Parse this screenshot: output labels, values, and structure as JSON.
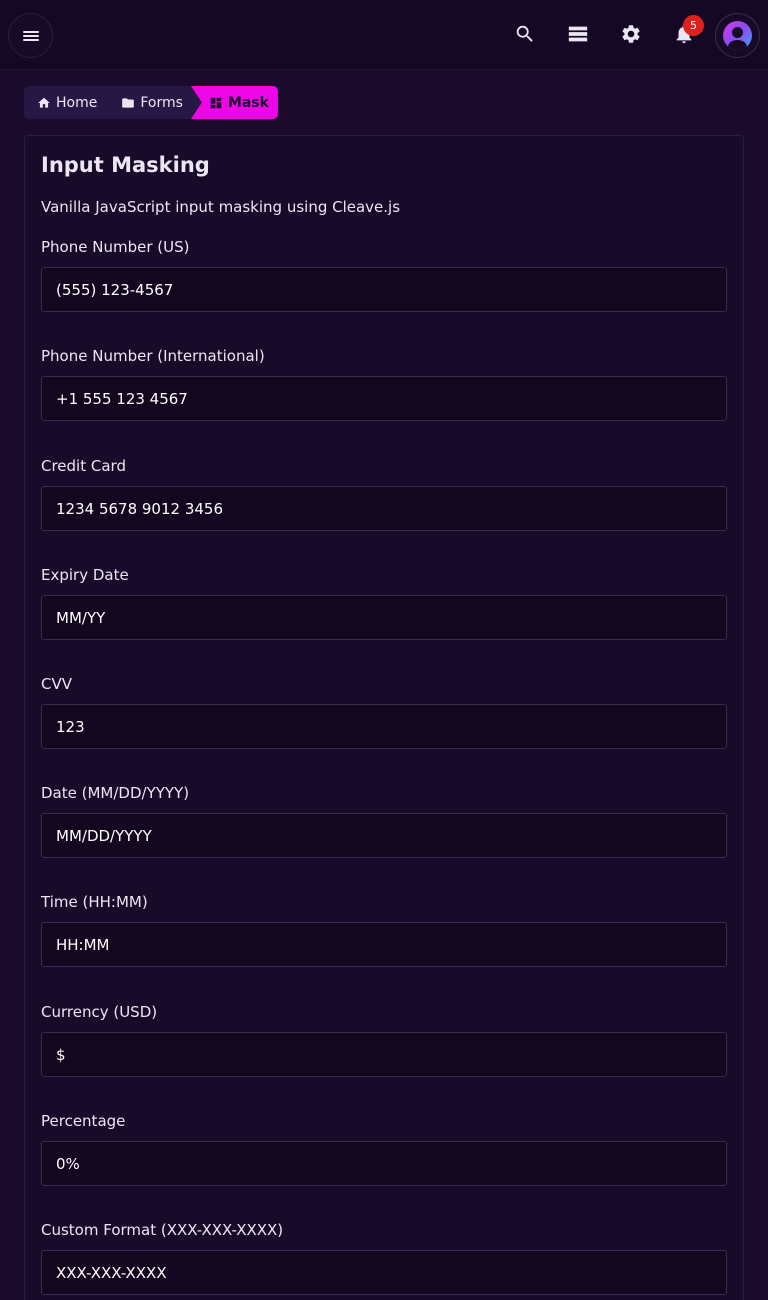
{
  "header": {
    "notification_count": "5",
    "icons": [
      "menu-icon",
      "search-icon",
      "storage-icon",
      "gear-icon",
      "bell-icon",
      "user-icon"
    ]
  },
  "breadcrumb": {
    "home": "Home",
    "forms": "Forms",
    "current": "Mask",
    "active_color": "#ee06e8"
  },
  "card": {
    "title": "Input Masking",
    "description": "Vanilla JavaScript input masking using Cleave.js"
  },
  "fields": [
    {
      "label": "Phone Number (US)",
      "value": "(555) 123-4567",
      "placeholder": ""
    },
    {
      "label": "Phone Number (International)",
      "value": "+1 555 123 4567",
      "placeholder": ""
    },
    {
      "label": "Credit Card",
      "value": "1234 5678 9012 3456",
      "placeholder": ""
    },
    {
      "label": "Expiry Date",
      "value": "",
      "placeholder": "MM/YY"
    },
    {
      "label": "CVV",
      "value": "",
      "placeholder": "123"
    },
    {
      "label": "Date (MM/DD/YYYY)",
      "value": "",
      "placeholder": "MM/DD/YYYY"
    },
    {
      "label": "Time (HH:MM)",
      "value": "",
      "placeholder": "HH:MM"
    },
    {
      "label": "Currency (USD)",
      "value": "",
      "placeholder": "$"
    },
    {
      "label": "Percentage",
      "value": "",
      "placeholder": "0%"
    },
    {
      "label": "Custom Format (XXX-XXX-XXXX)",
      "value": "",
      "placeholder": "XXX-XXX-XXXX"
    }
  ]
}
